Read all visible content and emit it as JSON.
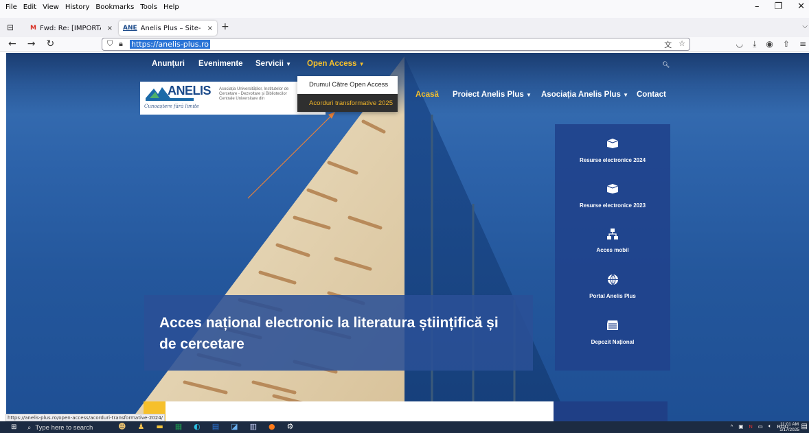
{
  "menubar": {
    "items": [
      "File",
      "Edit",
      "View",
      "History",
      "Bookmarks",
      "Tools",
      "Help"
    ]
  },
  "tabs": [
    {
      "favicon": "M",
      "title": "Fwd: Re: [IMPORTANT] Migrare",
      "close": "×"
    },
    {
      "favicon": "ANE",
      "title": "Anelis Plus – Site-ul proiectului",
      "close": "×"
    }
  ],
  "navbar": {
    "url": "https://anelis-plus.ro"
  },
  "site": {
    "topnav": [
      "Anunțuri",
      "Evenimente",
      "Servicii",
      "Open Access"
    ],
    "dropdown": [
      "Drumul Către Open Access",
      "Acorduri transformative 2025"
    ],
    "logo": {
      "brand": "ANELIS",
      "assoc": "Asociația Universităților, Institutelor de Cercetare - Dezvoltare și Bibliotecilor Centrale Universitare din",
      "signature": "Cunoaștere fără limite"
    },
    "mainnav": [
      "Acasă",
      "Proiect Anelis Plus",
      "Asociația Anelis Plus",
      "Contact"
    ],
    "quicklinks": [
      {
        "icon": "box-icon",
        "label": "Resurse electronice 2024"
      },
      {
        "icon": "box-icon",
        "label": "Resurse electronice 2023"
      },
      {
        "icon": "network-icon",
        "label": "Acces mobil"
      },
      {
        "icon": "globe-icon",
        "label": "Portal Anelis Plus"
      },
      {
        "icon": "archive-icon",
        "label": "Depozit Național"
      }
    ],
    "hero_title": "Acces național electronic la literatura științifică și de cercetare"
  },
  "status_url": "https://anelis-plus.ro/open-access/acorduri-transformative-2024/",
  "taskbar": {
    "search_placeholder": "Type here to search",
    "lang": "ROU",
    "time": "11:01 AM",
    "date": "1/17/2025"
  },
  "colors": {
    "accent_yellow": "#f6c02b",
    "site_blue": "#2d63aa",
    "panel_blue": "#20428c",
    "arrow_orange": "#e8813a"
  }
}
